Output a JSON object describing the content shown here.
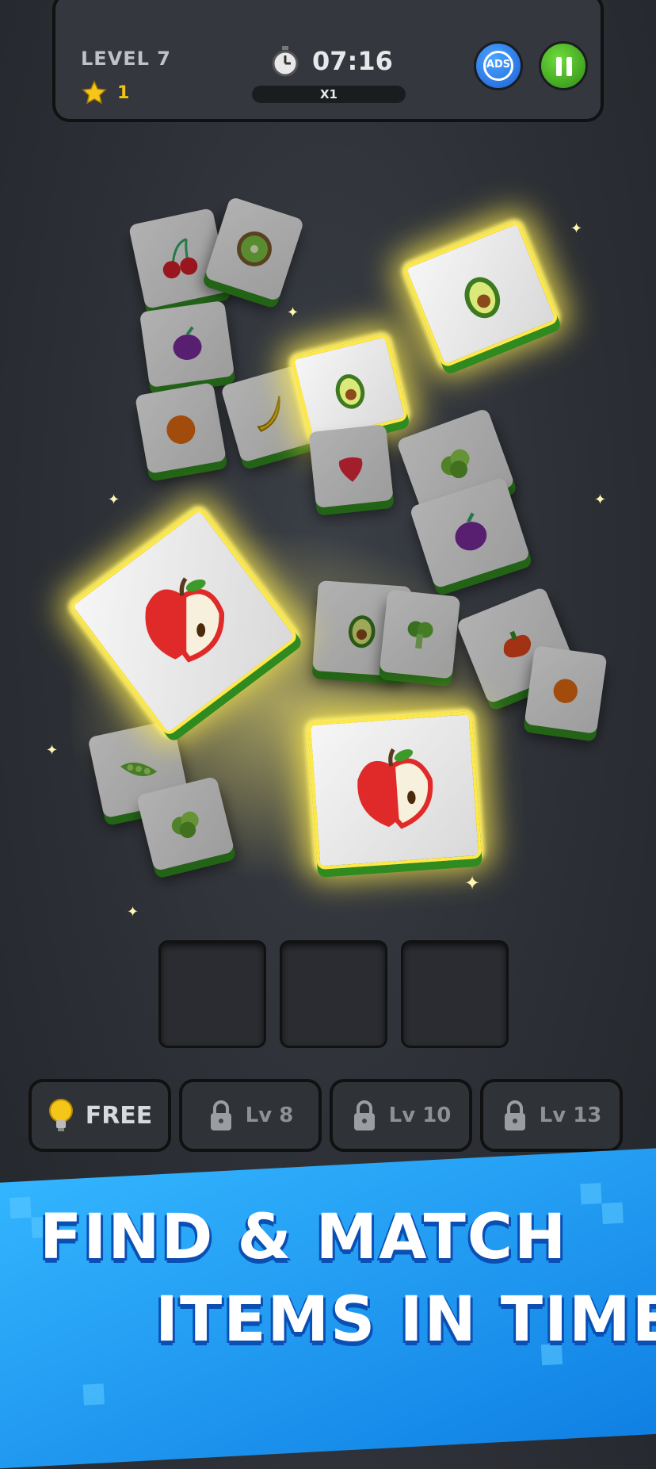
{
  "header": {
    "level_label": "LEVEL 7",
    "stars": "1",
    "timer": "07:16",
    "multiplier": "X1",
    "ads_label": "ADS"
  },
  "slots": {
    "count": 3
  },
  "tools": [
    {
      "label": "FREE",
      "icon": "lightbulb-icon"
    },
    {
      "label": "Lv 8",
      "icon": "lock-icon"
    },
    {
      "label": "Lv 10",
      "icon": "lock-icon"
    },
    {
      "label": "Lv 13",
      "icon": "lock-icon"
    }
  ],
  "banner": {
    "line1": "FIND & MATCH",
    "line2": "ITEMS IN TIME"
  },
  "tiles": [
    {
      "fruit": "cherry"
    },
    {
      "fruit": "kiwi"
    },
    {
      "fruit": "plum"
    },
    {
      "fruit": "orange"
    },
    {
      "fruit": "banana"
    },
    {
      "fruit": "avocado"
    },
    {
      "fruit": "avocado"
    },
    {
      "fruit": "strawberry"
    },
    {
      "fruit": "lettuce"
    },
    {
      "fruit": "plum"
    },
    {
      "fruit": "apple"
    },
    {
      "fruit": "apple"
    },
    {
      "fruit": "avocado"
    },
    {
      "fruit": "broccoli"
    },
    {
      "fruit": "pepper"
    },
    {
      "fruit": "pea-pod"
    },
    {
      "fruit": "lettuce"
    },
    {
      "fruit": "orange"
    }
  ],
  "colors": {
    "accent_green": "#2f8a1f",
    "glow": "#ffe94a",
    "banner_blue": "#1a95f0"
  }
}
